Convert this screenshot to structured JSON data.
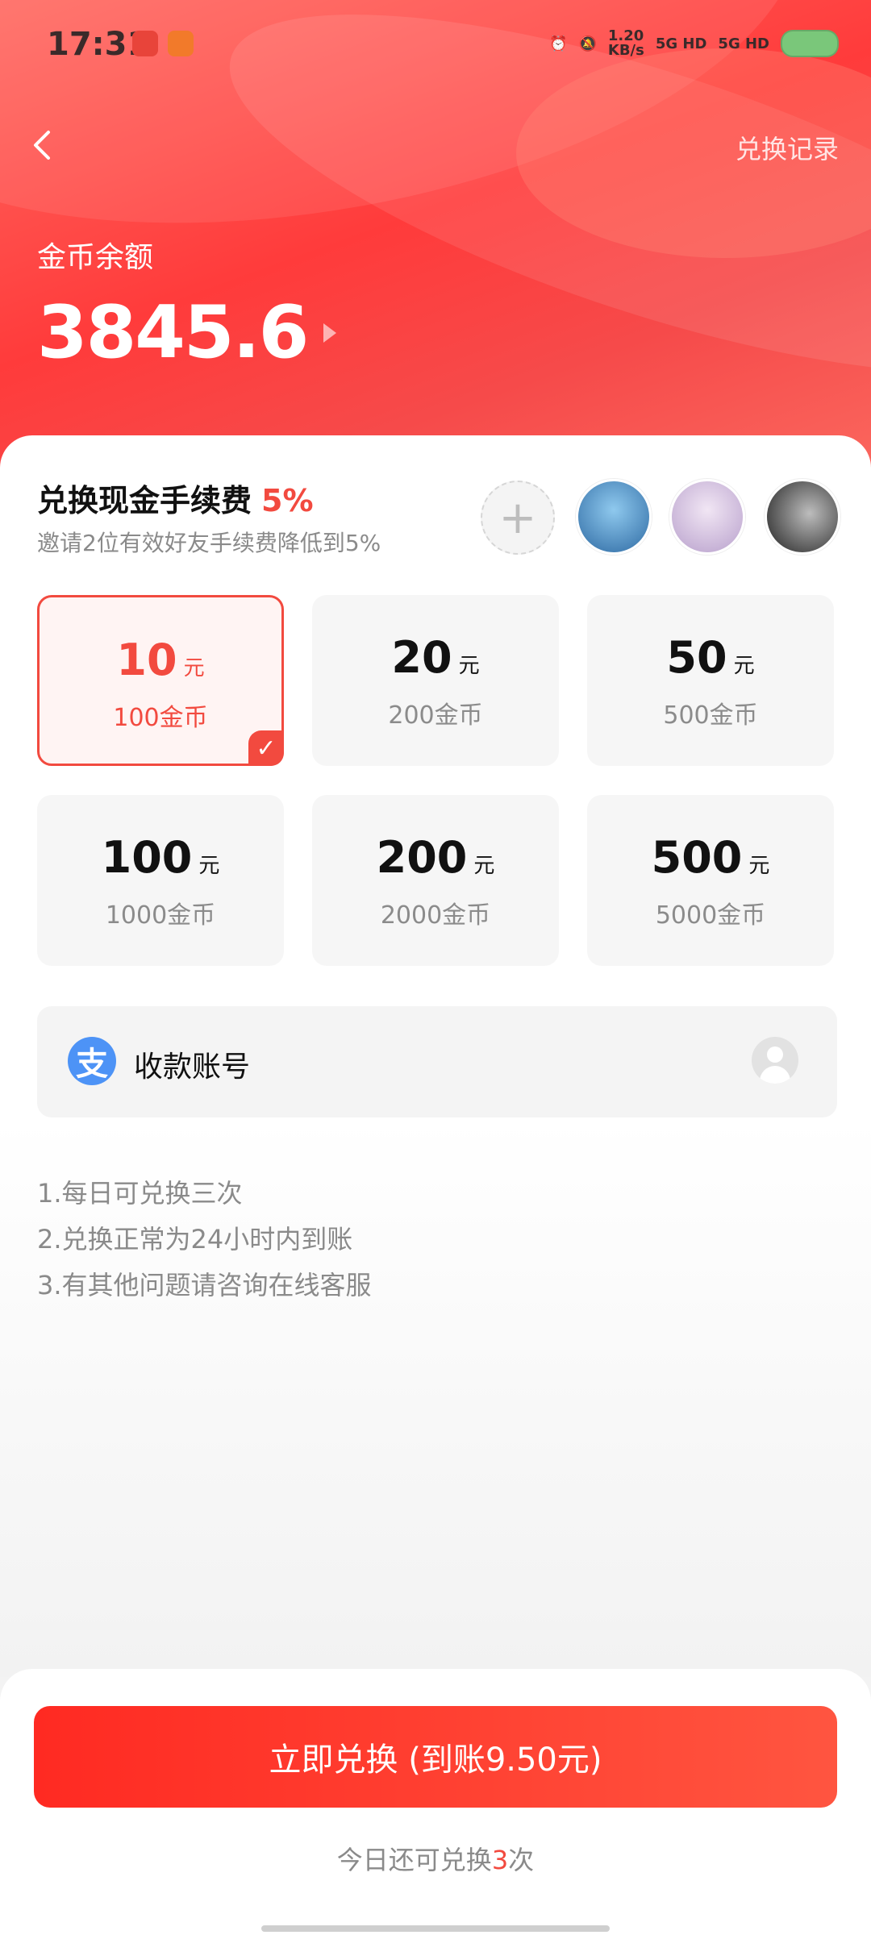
{
  "status_bar": {
    "time": "17:31",
    "net_speed": "1.20\nKB/s",
    "sim1": "5G HD",
    "sim2": "5G HD"
  },
  "header": {
    "record_link": "兑换记录",
    "balance_label": "金币余额",
    "balance_value": "3845.6"
  },
  "fee": {
    "title": "兑换现金手续费",
    "percent": "5%",
    "subtitle": "邀请2位有效好友手续费降低到5%"
  },
  "options": [
    {
      "amount": "10",
      "unit": "元",
      "coins": "100金币",
      "selected": true
    },
    {
      "amount": "20",
      "unit": "元",
      "coins": "200金币",
      "selected": false
    },
    {
      "amount": "50",
      "unit": "元",
      "coins": "500金币",
      "selected": false
    },
    {
      "amount": "100",
      "unit": "元",
      "coins": "1000金币",
      "selected": false
    },
    {
      "amount": "200",
      "unit": "元",
      "coins": "2000金币",
      "selected": false
    },
    {
      "amount": "500",
      "unit": "元",
      "coins": "5000金币",
      "selected": false
    }
  ],
  "account": {
    "label": "收款账号",
    "icon": "alipay-icon"
  },
  "rules": [
    "1.每日可兑换三次",
    "2.兑换正常为24小时内到账",
    "3.有其他问题请咨询在线客服"
  ],
  "cta": {
    "label": "立即兑换 (到账9.50元)"
  },
  "remaining": {
    "prefix": "今日还可兑换",
    "count": "3",
    "suffix": "次"
  },
  "colors": {
    "accent": "#f24a3f",
    "header_gradient_start": "#ff6a62",
    "header_gradient_end": "#fb6a60",
    "alipay_blue": "#4d93f6"
  }
}
